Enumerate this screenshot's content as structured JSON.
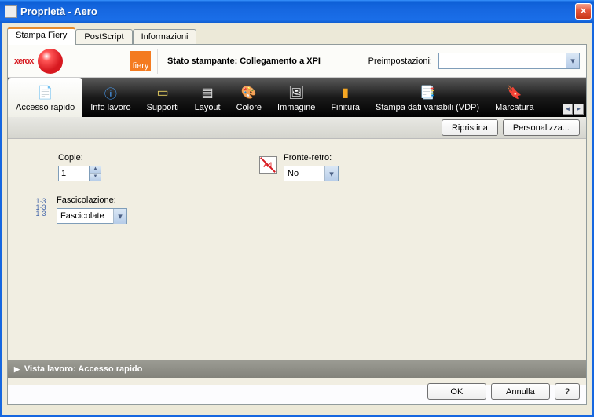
{
  "title": "Proprietà - Aero",
  "tabs": {
    "fiery": "Stampa Fiery",
    "postscript": "PostScript",
    "info": "Informazioni"
  },
  "header": {
    "brand": "xerox",
    "fiery": "fiery",
    "status": "Stato stampante: Collegamento a XPI",
    "presets_label": "Preimpostazioni:",
    "presets_value": ""
  },
  "toolbar": {
    "quick": "Accesso rapido",
    "jobinfo": "Info lavoro",
    "media": "Supporti",
    "layout": "Layout",
    "color": "Colore",
    "image": "Immagine",
    "finish": "Finitura",
    "vdp": "Stampa dati variabili (VDP)",
    "mark": "Marcatura"
  },
  "actions": {
    "reset": "Ripristina",
    "customize": "Personalizza..."
  },
  "form": {
    "copies_label": "Copie:",
    "copies_value": "1",
    "duplex_label": "Fronte-retro:",
    "duplex_value": "No",
    "collate_label": "Fascicolazione:",
    "collate_value": "Fascicolate"
  },
  "viewbar": "Vista lavoro: Accesso rapido",
  "footer": {
    "ok": "OK",
    "cancel": "Annulla",
    "help": "?"
  }
}
